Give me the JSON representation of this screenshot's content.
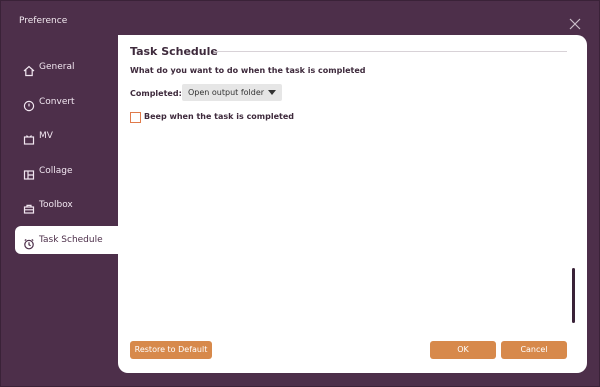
{
  "window": {
    "title": "Preference"
  },
  "sidebar": {
    "items": [
      {
        "label": "General",
        "icon": "home-icon",
        "active": false
      },
      {
        "label": "Convert",
        "icon": "convert-icon",
        "active": false
      },
      {
        "label": "MV",
        "icon": "mv-icon",
        "active": false
      },
      {
        "label": "Collage",
        "icon": "collage-icon",
        "active": false
      },
      {
        "label": "Toolbox",
        "icon": "toolbox-icon",
        "active": false
      },
      {
        "label": "Task Schedule",
        "icon": "alarm-clock-icon",
        "active": true
      }
    ]
  },
  "task_schedule": {
    "title": "Task Schedule",
    "question": "What do you want to do when the task is completed",
    "completed_label": "Completed:",
    "completed_value": "Open output folder",
    "beep_label": "Beep when the task is completed",
    "beep_checked": false
  },
  "buttons": {
    "restore_label": "Restore to Default",
    "ok_label": "OK",
    "cancel_label": "Cancel"
  },
  "colors": {
    "accent": "#d7894b",
    "window_bg": "#4d2f4a",
    "checkbox_border": "#e07a4a"
  }
}
